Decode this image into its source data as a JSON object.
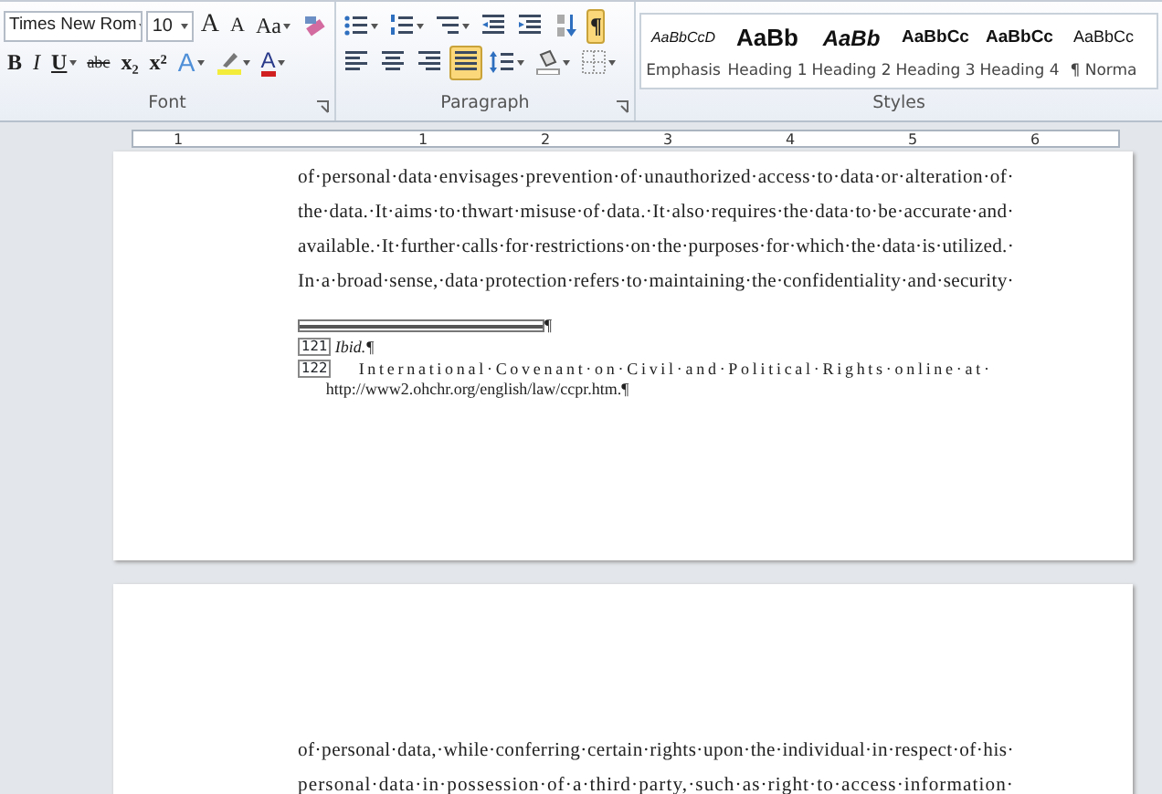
{
  "ribbon": {
    "font_group": {
      "label": "Font",
      "font_name": "Times New Rom",
      "font_size": "10",
      "row1": [
        {
          "kind": "grow",
          "glyph": "A"
        },
        {
          "kind": "shrink",
          "glyph": "A"
        },
        {
          "kind": "case",
          "glyph": "Aa"
        },
        {
          "kind": "clear"
        }
      ],
      "row2": [
        {
          "kind": "bold",
          "glyph": "B"
        },
        {
          "kind": "italic",
          "glyph": "I"
        },
        {
          "kind": "underline",
          "glyph": "U"
        },
        {
          "kind": "strike",
          "glyph": "abc"
        },
        {
          "kind": "sub",
          "glyph": "x₂"
        },
        {
          "kind": "sup",
          "glyph": "x²"
        },
        {
          "kind": "effects",
          "glyph": "A"
        },
        {
          "kind": "highlight"
        },
        {
          "kind": "color",
          "glyph": "A"
        }
      ]
    },
    "paragraph_group": {
      "label": "Paragraph",
      "row1": [
        {
          "kind": "bullets",
          "selected": false
        },
        {
          "kind": "numbering",
          "selected": false
        },
        {
          "kind": "multilevel",
          "selected": false
        },
        {
          "kind": "outdent",
          "selected": false
        },
        {
          "kind": "indent",
          "selected": false
        },
        {
          "kind": "sort",
          "selected": false
        },
        {
          "kind": "marks",
          "glyph": "¶",
          "selected": true
        }
      ],
      "row2": [
        {
          "kind": "left",
          "selected": false
        },
        {
          "kind": "center",
          "selected": false
        },
        {
          "kind": "right",
          "selected": false
        },
        {
          "kind": "justify",
          "selected": true
        },
        {
          "kind": "spacing",
          "selected": false
        },
        {
          "kind": "shading",
          "selected": false
        },
        {
          "kind": "borders",
          "selected": false
        }
      ]
    },
    "styles_group": {
      "label": "Styles",
      "styles": [
        {
          "kind": "emphasis",
          "preview": "AaBbCcD",
          "name": "Emphasis"
        },
        {
          "kind": "heading1",
          "preview": "AaBb",
          "name": "Heading 1"
        },
        {
          "kind": "heading2",
          "preview": "AaBb",
          "name": "Heading 2"
        },
        {
          "kind": "heading3",
          "preview": "AaBbCc",
          "name": "Heading 3"
        },
        {
          "kind": "heading4",
          "preview": "AaBbCc",
          "name": "Heading 4"
        },
        {
          "kind": "normal",
          "preview": "AaBbCc",
          "name": "¶ Norma"
        }
      ]
    }
  },
  "ruler": {
    "numbers": [
      "1",
      "1",
      "2",
      "3",
      "4",
      "5",
      "6"
    ]
  },
  "pages": [
    {
      "lines": [
        "of·personal·data·envisages·prevention·of·unauthorized·access·to·data·or·alteration·of·",
        "the·data.·It·aims·to·thwart·misuse·of·data.·It·also·requires·the·data·to·be·accurate·and·",
        "available.·It·further·calls·for·restrictions·on·the·purposes·for·which·the·data·is·utilized.·",
        "In·a·broad·sense,·data·protection·refers·to·maintaining·the·confidentiality·and·security·"
      ],
      "separator_mark": "¶",
      "footnotes": [
        {
          "mark": "121",
          "lines": [
            "Ibid.¶"
          ],
          "italic": true
        },
        {
          "mark": "122",
          "lines": [
            "International·Covenant·on·Civil·and·Political·Rights·online·at·",
            "http://www2.ohchr.org/english/law/ccpr.htm.¶"
          ],
          "italic": false
        }
      ]
    },
    {
      "lines": [
        "of·personal·data,·while·conferring·certain·rights·upon·the·individual·in·respect·of·his·",
        "personal·data·in·possession·of·a·third·party,·such·as·right·to·access·information·"
      ]
    }
  ]
}
